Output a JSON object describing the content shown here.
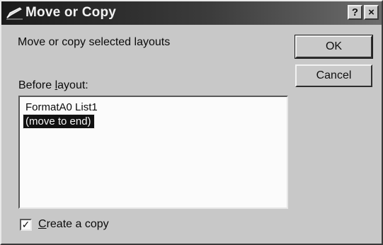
{
  "window": {
    "title": "Move or Copy",
    "help_button": "?",
    "close_button": "×"
  },
  "dialog": {
    "description": "Move or copy selected layouts",
    "list_label_prefix": "Before ",
    "list_label_underlined": "l",
    "list_label_suffix": "ayout:",
    "list_items": [
      {
        "label": "FormatA0 List1",
        "selected": false
      },
      {
        "label": "(move to end)",
        "selected": true
      }
    ],
    "ok_label": "OK",
    "cancel_label": "Cancel",
    "create_copy": {
      "checked": true,
      "check_mark": "✓",
      "label_underlined": "C",
      "label_rest": "reate a copy"
    }
  }
}
